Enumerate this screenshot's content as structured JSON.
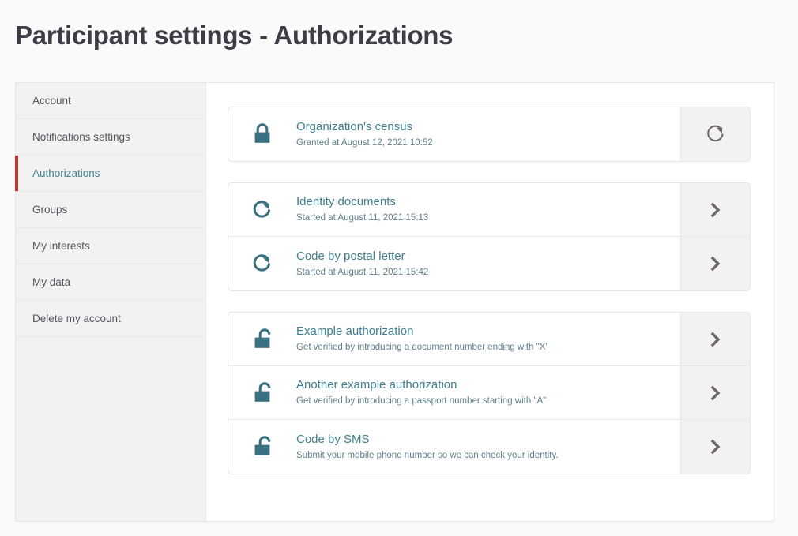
{
  "page": {
    "title": "Participant settings - Authorizations"
  },
  "colors": {
    "accent_teal": "#3f7f8f",
    "icon_teal": "#3a7180",
    "active_marker_red": "#c0392b",
    "panel_bg": "#ffffff",
    "sidebar_bg": "#f2f2f2",
    "page_bg": "#fafafa",
    "action_bg": "#f2f2f2",
    "chevron_gray": "#6e666c"
  },
  "sidebar": {
    "items": [
      {
        "label": "Account",
        "active": false
      },
      {
        "label": "Notifications settings",
        "active": false
      },
      {
        "label": "Authorizations",
        "active": true
      },
      {
        "label": "Groups",
        "active": false
      },
      {
        "label": "My interests",
        "active": false
      },
      {
        "label": "My data",
        "active": false
      },
      {
        "label": "Delete my account",
        "active": false
      }
    ]
  },
  "groups": [
    {
      "name": "granted-authorizations",
      "rows": [
        {
          "title": "Organization's census",
          "subtitle": "Granted at August 12, 2021 10:52",
          "icon": "lock-closed-icon",
          "action_icon": "refresh-icon"
        }
      ]
    },
    {
      "name": "pending-authorizations",
      "rows": [
        {
          "title": "Identity documents",
          "subtitle": "Started at August 11, 2021 15:13",
          "icon": "refresh-circle-icon",
          "action_icon": "chevron-right-icon"
        },
        {
          "title": "Code by postal letter",
          "subtitle": "Started at August 11, 2021 15:42",
          "icon": "refresh-circle-icon",
          "action_icon": "chevron-right-icon"
        }
      ]
    },
    {
      "name": "available-authorizations",
      "rows": [
        {
          "title": "Example authorization",
          "subtitle": "Get verified by introducing a document number ending with \"X\"",
          "icon": "lock-open-icon",
          "action_icon": "chevron-right-icon"
        },
        {
          "title": "Another example authorization",
          "subtitle": "Get verified by introducing a passport number starting with \"A\"",
          "icon": "lock-open-icon",
          "action_icon": "chevron-right-icon"
        },
        {
          "title": "Code by SMS",
          "subtitle": "Submit your mobile phone number so we can check your identity.",
          "icon": "lock-open-icon",
          "action_icon": "chevron-right-icon"
        }
      ]
    }
  ],
  "icons": {
    "chevron_right_glyph": "›"
  }
}
